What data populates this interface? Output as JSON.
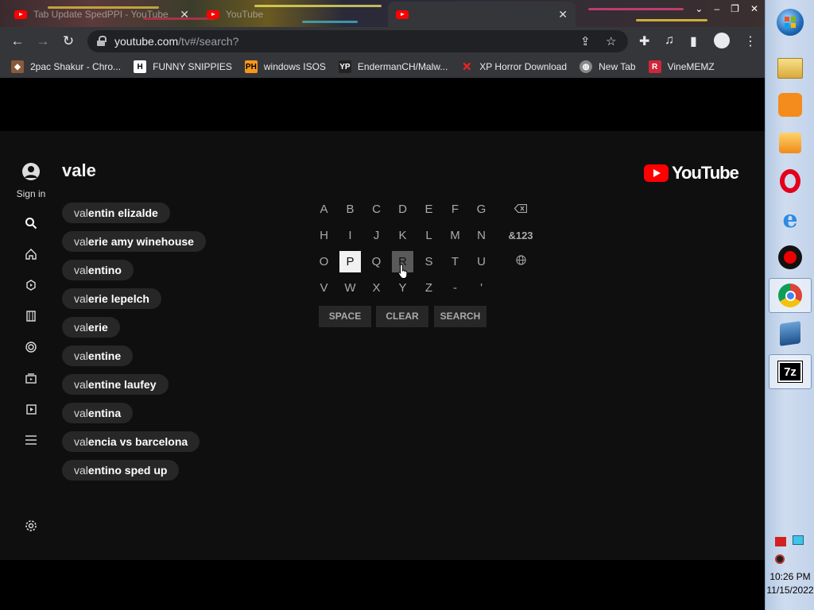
{
  "browser": {
    "tabs": [
      {
        "label": "Tab Update SpedPPI - YouTube",
        "active": false
      },
      {
        "label": "YouTube",
        "active": false
      },
      {
        "label": "",
        "active": true
      }
    ],
    "url_host": "youtube.com",
    "url_path": "/tv#/search?",
    "bookmarks": [
      {
        "label": "2pac Shakur - Chro...",
        "icon": "2pac-icon"
      },
      {
        "label": "FUNNY SNIPPIES",
        "icon": "h-icon"
      },
      {
        "label": "windows ISOS",
        "icon": "ph-icon"
      },
      {
        "label": "EndermanCH/Malw...",
        "icon": "yp-icon"
      },
      {
        "label": "XP Horror Download",
        "icon": "x-icon"
      },
      {
        "label": "New Tab",
        "icon": "globe-icon"
      },
      {
        "label": "VineMEMZ",
        "icon": "r-icon"
      }
    ]
  },
  "youtube": {
    "sign_in_label": "Sign in",
    "query": "vale",
    "logo_text": "YouTube",
    "suggestions": [
      {
        "prefix": "val",
        "rest": "entin elizalde"
      },
      {
        "prefix": "val",
        "rest": "erie amy winehouse"
      },
      {
        "prefix": "val",
        "rest": "entino"
      },
      {
        "prefix": "val",
        "rest": "erie lepelch"
      },
      {
        "prefix": "val",
        "rest": "erie"
      },
      {
        "prefix": "val",
        "rest": "entine"
      },
      {
        "prefix": "val",
        "rest": "entine laufey"
      },
      {
        "prefix": "val",
        "rest": "entina"
      },
      {
        "prefix": "val",
        "rest": "encia vs barcelona"
      },
      {
        "prefix": "val",
        "rest": "entino sped up"
      }
    ],
    "keyboard_rows": [
      [
        "A",
        "B",
        "C",
        "D",
        "E",
        "F",
        "G"
      ],
      [
        "H",
        "I",
        "J",
        "K",
        "L",
        "M",
        "N"
      ],
      [
        "O",
        "P",
        "Q",
        "R",
        "S",
        "T",
        "U"
      ],
      [
        "V",
        "W",
        "X",
        "Y",
        "Z",
        "-",
        "'"
      ]
    ],
    "symbols_key": "&123",
    "selected_key": "P",
    "hovered_key": "R",
    "actions": [
      "SPACE",
      "CLEAR",
      "SEARCH"
    ]
  },
  "taskbar": {
    "time": "10:26 PM",
    "date": "11/15/2022",
    "apps": [
      "start-orb-icon",
      "file-explorer-icon",
      "uc-browser-icon",
      "media-player-icon",
      "opera-icon",
      "internet-explorer-icon",
      "screen-recorder-icon",
      "chrome-icon",
      "virtualbox-icon",
      "7zip-icon"
    ],
    "seven_zip_label": "7z"
  },
  "colors": {
    "youtube_red": "#ff0000",
    "page_bg": "#0f0f0f",
    "chip_bg": "#272727"
  }
}
